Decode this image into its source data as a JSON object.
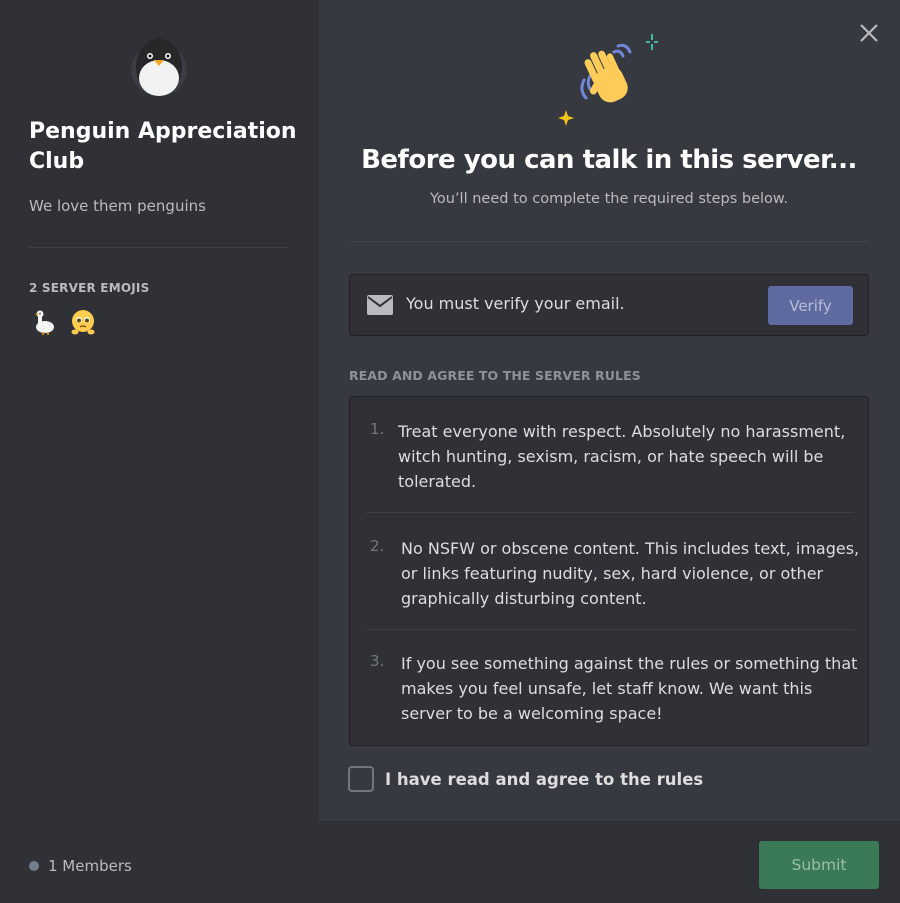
{
  "server": {
    "name": "Penguin Appreciation Club",
    "description": "We love them penguins",
    "emoji_heading": "2 SERVER EMOJIS",
    "emojis": [
      "goose-emoji",
      "pleading-emoji"
    ],
    "members": "1 Members"
  },
  "main": {
    "title": "Before you can talk in this server...",
    "subtitle": "You’ll need to complete the required steps below.",
    "verify_text": "You must verify your email.",
    "verify_button": "Verify",
    "rules_heading": "READ AND AGREE TO THE SERVER RULES",
    "rules": [
      {
        "number": "1.",
        "text": "Treat everyone with respect. Absolutely no harassment, witch hunting, sexism, racism, or hate speech will be tolerated."
      },
      {
        "number": "2.",
        "text": "No NSFW or obscene content. This includes text, images, or links featuring nudity, sex, hard violence, or other graphically disturbing content."
      },
      {
        "number": "3.",
        "text": "If you see something against the rules or something that makes you feel unsafe, let staff know. We want this server to be a welcoming space!"
      }
    ],
    "agree_label": "I have read and agree to the rules",
    "submit_button": "Submit"
  },
  "icons": {
    "server_icon": "penguin-icon",
    "hero_icon": "waving-hand-icon",
    "mail_icon": "envelope-icon",
    "close_icon": "close-icon"
  },
  "colors": {
    "verify_button": "#5f6aa0",
    "submit_button": "#3a7a57"
  }
}
